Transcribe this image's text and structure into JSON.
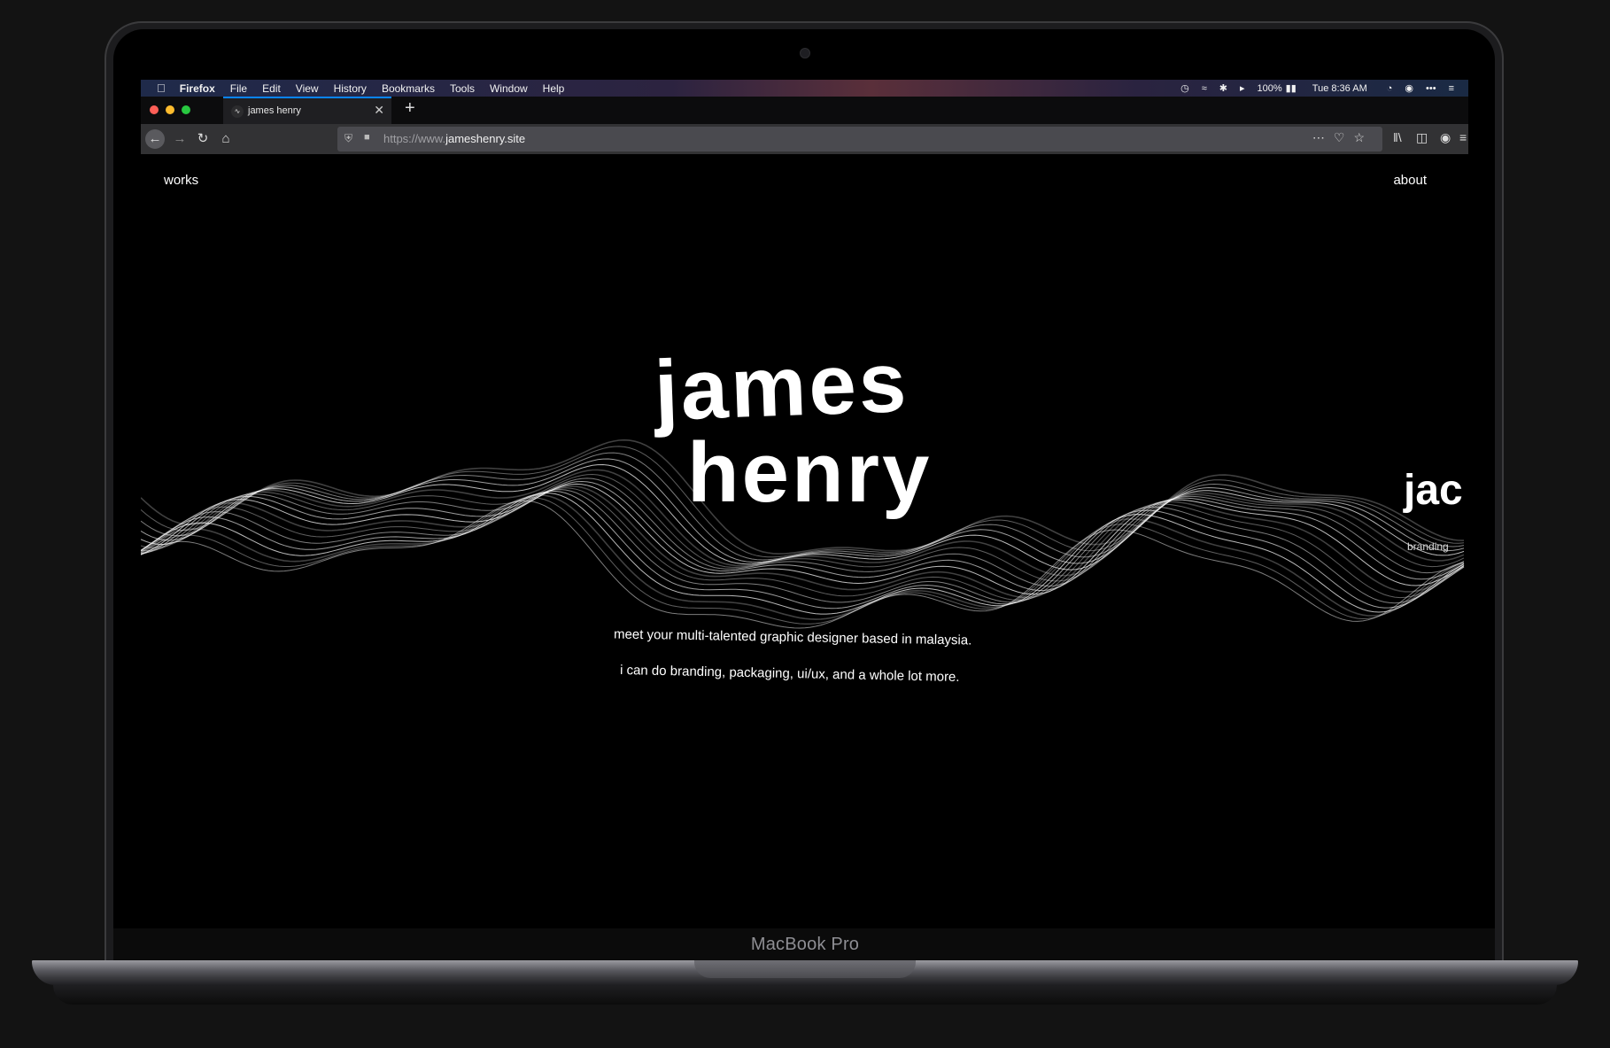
{
  "device": {
    "label": "MacBook Pro"
  },
  "menubar": {
    "app": "Firefox",
    "items": [
      "File",
      "Edit",
      "View",
      "History",
      "Bookmarks",
      "Tools",
      "Window",
      "Help"
    ],
    "battery": "100%",
    "clock": "Tue 8:36 AM"
  },
  "browser": {
    "tab_title": "james henry",
    "url_prefix": "https://www.",
    "url_domain": "jameshenry.site"
  },
  "site": {
    "nav_left": "works",
    "nav_right": "about",
    "hero_line1": "james",
    "hero_line2": "henry",
    "tagline1": "meet your multi-talented graphic designer based in malaysia.",
    "tagline2": "i can do branding, packaging, ui/ux, and a whole lot more.",
    "side_title": "jac",
    "side_sub": "branding"
  }
}
